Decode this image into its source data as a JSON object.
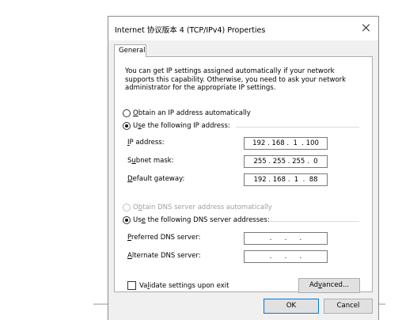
{
  "window": {
    "title": "Internet 协议版本 4 (TCP/IPv4) Properties"
  },
  "tabs": [
    {
      "label": "General"
    }
  ],
  "description": "You can get IP settings assigned automatically if your network supports this capability. Otherwise, you need to ask your network administrator for the appropriate IP settings.",
  "ip_section": {
    "auto_label_key": "O",
    "auto_label_rest": "btain an IP address automatically",
    "auto_selected": false,
    "manual_label_pre": "U",
    "manual_label_key": "s",
    "manual_label_rest": "e the following IP address:",
    "manual_selected": true,
    "fields": [
      {
        "label_key": "I",
        "label_rest": "P address:",
        "value": "192 . 168 .  1  . 100"
      },
      {
        "label_pre": "S",
        "label_key": "u",
        "label_rest": "bnet mask:",
        "value": "255 . 255 . 255 .  0"
      },
      {
        "label_key": "D",
        "label_rest": "efault gateway:",
        "value": "192 . 168 .  1  .  88"
      }
    ]
  },
  "dns_section": {
    "auto_label_pre": "O",
    "auto_label_key": "b",
    "auto_label_rest": "tain DNS server address automatically",
    "auto_selected": false,
    "auto_disabled": true,
    "manual_label_pre": "Us",
    "manual_label_key": "e",
    "manual_label_rest": " the following DNS server addresses:",
    "manual_selected": true,
    "fields": [
      {
        "label_key": "P",
        "label_rest": "referred DNS server:",
        "value": "  .      .      .  "
      },
      {
        "label_key": "A",
        "label_rest": "lternate DNS server:",
        "value": "  .      .      .  "
      }
    ]
  },
  "validate": {
    "label_pre": "Va",
    "label_key": "l",
    "label_rest": "idate settings upon exit",
    "checked": false
  },
  "buttons": {
    "advanced_pre": "Ad",
    "advanced_key": "v",
    "advanced_rest": "anced...",
    "ok": "OK",
    "cancel": "Cancel"
  }
}
